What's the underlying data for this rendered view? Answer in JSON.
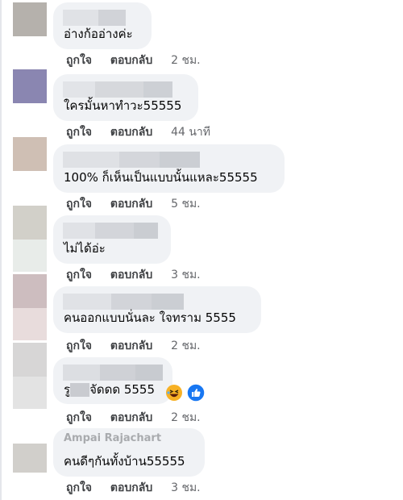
{
  "comments": [
    {
      "text": "อ่างก้ออ่างค่ะ",
      "like": "ถูกใจ",
      "reply": "ตอบกลับ",
      "time": "2 ชม."
    },
    {
      "text": "ใครมั้นหาทำวะ55555",
      "like": "ถูกใจ",
      "reply": "ตอบกลับ",
      "time": "44 นาที"
    },
    {
      "text": "100% ก็เห็นเป็นแบบนั้นแหละ55555",
      "like": "ถูกใจ",
      "reply": "ตอบกลับ",
      "time": "5 ชม."
    },
    {
      "text": "ไม่ได้อ่ะ",
      "like": "ถูกใจ",
      "reply": "ตอบกลับ",
      "time": "3 ชม."
    },
    {
      "text": "คนออกแบบนั่นละ ใจทราม 5555",
      "like": "ถูกใจ",
      "reply": "ตอบกลับ",
      "time": "2 ชม."
    },
    {
      "text_prefix": "รู",
      "text_suffix": "จัดดด 5555",
      "reactions": [
        "haha-icon",
        "like-icon"
      ],
      "like": "ถูกใจ",
      "reply": "ตอบกลับ",
      "time": "2 ชม."
    },
    {
      "name_partial": "Ampai Rajachart",
      "text": "คนดีๆกันทั้งบ้าน55555",
      "like": "ถูกใจ",
      "reply": "ตอบกลับ",
      "time": "3 ชม."
    }
  ],
  "colors": {
    "bubble": "#f0f2f5",
    "blur": "#d8dadf",
    "action_text": "#404245",
    "time_text": "#65676b",
    "like_blue": "#1877f2",
    "haha_yellow": "#f7b125"
  }
}
